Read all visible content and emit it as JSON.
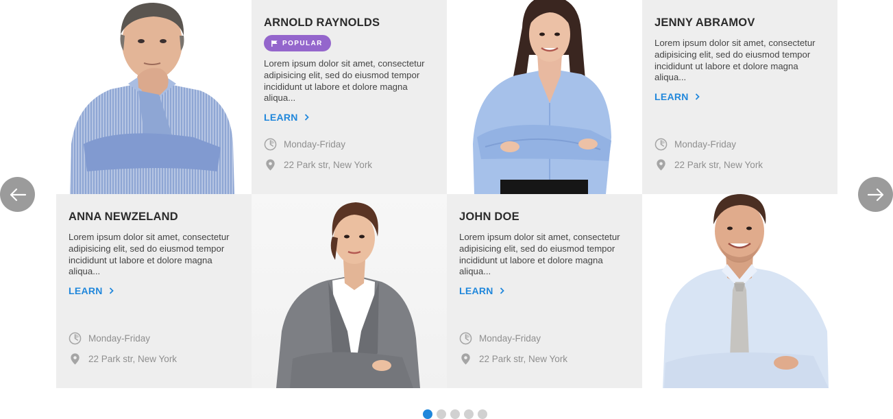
{
  "team": {
    "cards": [
      {
        "name": "ARNOLD RAYNOLDS",
        "badge": "POPULAR",
        "description": "Lorem ipsum dolor sit amet, consectetur adipisicing elit, sed do eiusmod tempor incididunt ut labore et dolore magna aliqua...",
        "learn_label": "LEARN",
        "hours": "Monday-Friday",
        "address": "22 Park str, New York"
      },
      {
        "name": "JENNY ABRAMOV",
        "description": "Lorem ipsum dolor sit amet, consectetur adipisicing elit, sed do eiusmod tempor incididunt ut labore et dolore magna aliqua...",
        "learn_label": "LEARN",
        "hours": "Monday-Friday",
        "address": "22 Park str, New York"
      },
      {
        "name": "ANNA NEWZELAND",
        "description": "Lorem ipsum dolor sit amet, consectetur adipisicing elit, sed do eiusmod tempor incididunt ut labore et dolore magna aliqua...",
        "learn_label": "LEARN",
        "hours": "Monday-Friday",
        "address": "22 Park str, New York"
      },
      {
        "name": "JOHN DOE",
        "description": "Lorem ipsum dolor sit amet, consectetur adipisicing elit, sed do eiusmod tempor incididunt ut labore et dolore magna aliqua...",
        "learn_label": "LEARN",
        "hours": "Monday-Friday",
        "address": "22 Park str, New York"
      }
    ]
  },
  "carousel": {
    "prev_icon": "arrow-left-icon",
    "next_icon": "arrow-right-icon",
    "page_count": 5,
    "active_page": 1
  },
  "colors": {
    "accent": "#2087db",
    "badge": "#9466cc",
    "card_bg": "#eeeeee",
    "arrow_bg": "#9b9b9b",
    "dot_inactive": "#d1d1d1"
  },
  "icons": {
    "badge": "flag-icon",
    "learn": "chevron-right-icon",
    "hours": "clock-icon",
    "address": "map-pin-icon"
  }
}
